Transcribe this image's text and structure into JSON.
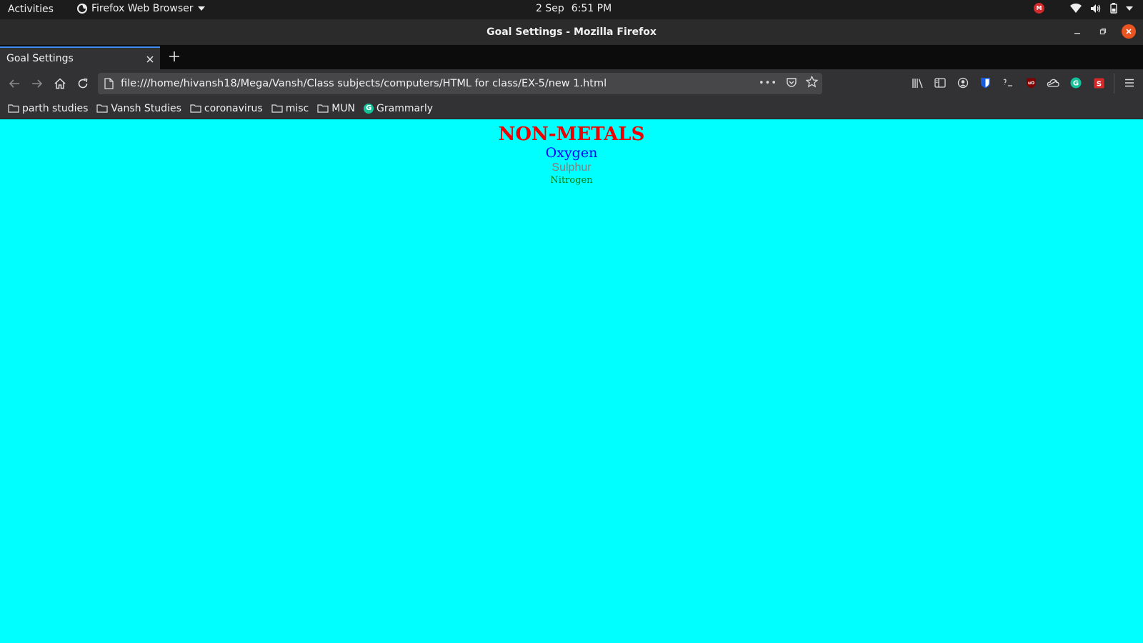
{
  "topbar": {
    "activities": "Activities",
    "app_name": "Firefox Web Browser",
    "date": "2 Sep",
    "time": "6:51 PM",
    "gmail_badge": "M"
  },
  "window": {
    "title": "Goal Settings - Mozilla Firefox"
  },
  "tabs": [
    {
      "label": "Goal Settings",
      "active": true
    }
  ],
  "navbar": {
    "url": "file:///home/hivansh18/Mega/Vansh/Class subjects/computers/HTML for class/EX-5/new 1.html",
    "more_actions": "•••"
  },
  "bookmarks": [
    {
      "label": "parth studies",
      "icon": "folder-icon"
    },
    {
      "label": "Vansh Studies",
      "icon": "folder-icon"
    },
    {
      "label": "coronavirus",
      "icon": "folder-icon"
    },
    {
      "label": "misc",
      "icon": "folder-icon"
    },
    {
      "label": "MUN",
      "icon": "folder-icon"
    },
    {
      "label": "Grammarly",
      "icon": "grammarly-icon",
      "icon_letter": "G"
    }
  ],
  "page": {
    "background": "#00ffff",
    "heading": "NON-METALS",
    "heading_color": "#ee0000",
    "items": [
      {
        "text": "Oxygen",
        "color": "#0000ff"
      },
      {
        "text": "Sulphur",
        "color": "#808080"
      },
      {
        "text": "Nitrogen",
        "color": "#008000"
      }
    ]
  }
}
